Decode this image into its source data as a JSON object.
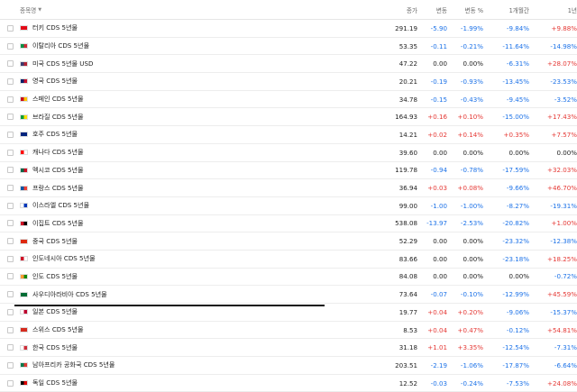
{
  "header": {
    "name": "종목명",
    "last": "종가",
    "chg": "변동",
    "pct": "변동 %",
    "m1": "1개월간",
    "y1": "1년"
  },
  "rows": [
    {
      "name": "터키 CDS 5년물",
      "flag": "turkey-flag",
      "colors": [
        "#e30a17",
        "#e30a17"
      ],
      "last": "291.19",
      "chg": "-5.90",
      "pct": "-1.99%",
      "m1": "-9.84%",
      "y1": "+9.88%",
      "c": [
        "neg",
        "neg",
        "neg",
        "pos"
      ]
    },
    {
      "name": "이탈리아 CDS 5년물",
      "flag": "italy-flag",
      "colors": [
        "#009246",
        "#ce2b37"
      ],
      "last": "53.35",
      "chg": "-0.11",
      "pct": "-0.21%",
      "m1": "-11.64%",
      "y1": "-14.98%",
      "c": [
        "neg",
        "neg",
        "neg",
        "neg"
      ]
    },
    {
      "name": "미국 CDS 5년물 USD",
      "flag": "usa-flag",
      "colors": [
        "#3c3b6e",
        "#b22234"
      ],
      "last": "47.22",
      "chg": "0.00",
      "pct": "0.00%",
      "m1": "-6.31%",
      "y1": "+28.07%",
      "c": [
        "neu",
        "neu",
        "neg",
        "pos"
      ]
    },
    {
      "name": "영국 CDS 5년물",
      "flag": "uk-flag",
      "colors": [
        "#012169",
        "#c8102e"
      ],
      "last": "20.21",
      "chg": "-0.19",
      "pct": "-0.93%",
      "m1": "-13.45%",
      "y1": "-23.53%",
      "c": [
        "neg",
        "neg",
        "neg",
        "neg"
      ]
    },
    {
      "name": "스페인 CDS 5년물",
      "flag": "spain-flag",
      "colors": [
        "#c60b1e",
        "#ffc400"
      ],
      "last": "34.78",
      "chg": "-0.15",
      "pct": "-0.43%",
      "m1": "-9.45%",
      "y1": "-3.52%",
      "c": [
        "neg",
        "neg",
        "neg",
        "neg"
      ]
    },
    {
      "name": "브라질 CDS 5년물",
      "flag": "brazil-flag",
      "colors": [
        "#009c3b",
        "#ffdf00"
      ],
      "last": "164.93",
      "chg": "+0.16",
      "pct": "+0.10%",
      "m1": "-15.00%",
      "y1": "+17.43%",
      "c": [
        "pos",
        "pos",
        "neg",
        "pos"
      ]
    },
    {
      "name": "호주 CDS 5년물",
      "flag": "australia-flag",
      "colors": [
        "#00247d",
        "#00247d"
      ],
      "last": "14.21",
      "chg": "+0.02",
      "pct": "+0.14%",
      "m1": "+0.35%",
      "y1": "+7.57%",
      "c": [
        "pos",
        "pos",
        "pos",
        "pos"
      ]
    },
    {
      "name": "캐나다 CDS 5년물",
      "flag": "canada-flag",
      "colors": [
        "#ff0000",
        "#ffffff"
      ],
      "last": "39.60",
      "chg": "0.00",
      "pct": "0.00%",
      "m1": "0.00%",
      "y1": "0.00%",
      "c": [
        "neu",
        "neu",
        "neu",
        "neu"
      ]
    },
    {
      "name": "멕시코 CDS 5년물",
      "flag": "mexico-flag",
      "colors": [
        "#006847",
        "#ce1126"
      ],
      "last": "119.78",
      "chg": "-0.94",
      "pct": "-0.78%",
      "m1": "-17.59%",
      "y1": "+32.03%",
      "c": [
        "neg",
        "neg",
        "neg",
        "pos"
      ]
    },
    {
      "name": "프랑스 CDS 5년물",
      "flag": "france-flag",
      "colors": [
        "#0055a4",
        "#ef4135"
      ],
      "last": "36.94",
      "chg": "+0.03",
      "pct": "+0.08%",
      "m1": "-9.66%",
      "y1": "+46.70%",
      "c": [
        "pos",
        "pos",
        "neg",
        "pos"
      ]
    },
    {
      "name": "이스라엘 CDS 5년물",
      "flag": "israel-flag",
      "colors": [
        "#ffffff",
        "#0038b8"
      ],
      "last": "99.00",
      "chg": "-1.00",
      "pct": "-1.00%",
      "m1": "-8.27%",
      "y1": "-19.31%",
      "c": [
        "neg",
        "neg",
        "neg",
        "neg"
      ]
    },
    {
      "name": "이집트 CDS 5년물",
      "flag": "egypt-flag",
      "colors": [
        "#ce1126",
        "#000000"
      ],
      "last": "538.08",
      "chg": "-13.97",
      "pct": "-2.53%",
      "m1": "-20.82%",
      "y1": "+1.00%",
      "c": [
        "neg",
        "neg",
        "neg",
        "pos"
      ]
    },
    {
      "name": "중국 CDS 5년물",
      "flag": "china-flag",
      "colors": [
        "#de2910",
        "#de2910"
      ],
      "last": "52.29",
      "chg": "0.00",
      "pct": "0.00%",
      "m1": "-23.32%",
      "y1": "-12.38%",
      "c": [
        "neu",
        "neu",
        "neg",
        "neg"
      ]
    },
    {
      "name": "인도네시아 CDS 5년물",
      "flag": "indonesia-flag",
      "colors": [
        "#ce1126",
        "#ffffff"
      ],
      "last": "83.66",
      "chg": "0.00",
      "pct": "0.00%",
      "m1": "-23.18%",
      "y1": "+18.25%",
      "c": [
        "neu",
        "neu",
        "neg",
        "pos"
      ]
    },
    {
      "name": "인도 CDS 5년물",
      "flag": "india-flag",
      "colors": [
        "#ff9933",
        "#138808"
      ],
      "last": "84.08",
      "chg": "0.00",
      "pct": "0.00%",
      "m1": "0.00%",
      "y1": "-0.72%",
      "c": [
        "neu",
        "neu",
        "neu",
        "neg"
      ]
    },
    {
      "name": "사우디아라비아 CDS 5년물",
      "flag": "saudi-flag",
      "colors": [
        "#006c35",
        "#006c35"
      ],
      "last": "73.64",
      "chg": "-0.07",
      "pct": "-0.10%",
      "m1": "-12.99%",
      "y1": "+45.59%",
      "c": [
        "neg",
        "neg",
        "neg",
        "pos"
      ]
    },
    {
      "name": "일본 CDS 5년물",
      "flag": "japan-flag",
      "colors": [
        "#ffffff",
        "#bc002d"
      ],
      "last": "19.77",
      "chg": "+0.04",
      "pct": "+0.20%",
      "m1": "-9.06%",
      "y1": "-15.37%",
      "c": [
        "pos",
        "pos",
        "neg",
        "neg"
      ]
    },
    {
      "name": "스위스 CDS 5년물",
      "flag": "switzerland-flag",
      "colors": [
        "#d52b1e",
        "#d52b1e"
      ],
      "last": "8.53",
      "chg": "+0.04",
      "pct": "+0.47%",
      "m1": "-0.12%",
      "y1": "+54.81%",
      "c": [
        "pos",
        "pos",
        "neg",
        "pos"
      ]
    },
    {
      "name": "한국 CDS 5년물",
      "flag": "korea-flag",
      "colors": [
        "#ffffff",
        "#cd2e3a"
      ],
      "last": "31.18",
      "chg": "+1.01",
      "pct": "+3.35%",
      "m1": "-12.54%",
      "y1": "-7.31%",
      "c": [
        "pos",
        "pos",
        "neg",
        "neg"
      ]
    },
    {
      "name": "남아프리카 공화국 CDS 5년물",
      "flag": "south-africa-flag",
      "colors": [
        "#007a4d",
        "#de3831"
      ],
      "last": "203.51",
      "chg": "-2.19",
      "pct": "-1.06%",
      "m1": "-17.87%",
      "y1": "-6.64%",
      "c": [
        "neg",
        "neg",
        "neg",
        "neg"
      ]
    },
    {
      "name": "독일 CDS 5년물",
      "flag": "germany-flag",
      "colors": [
        "#000000",
        "#dd0000"
      ],
      "last": "12.52",
      "chg": "-0.03",
      "pct": "-0.24%",
      "m1": "-7.53%",
      "y1": "+24.08%",
      "c": [
        "neg",
        "neg",
        "neg",
        "pos"
      ]
    }
  ]
}
